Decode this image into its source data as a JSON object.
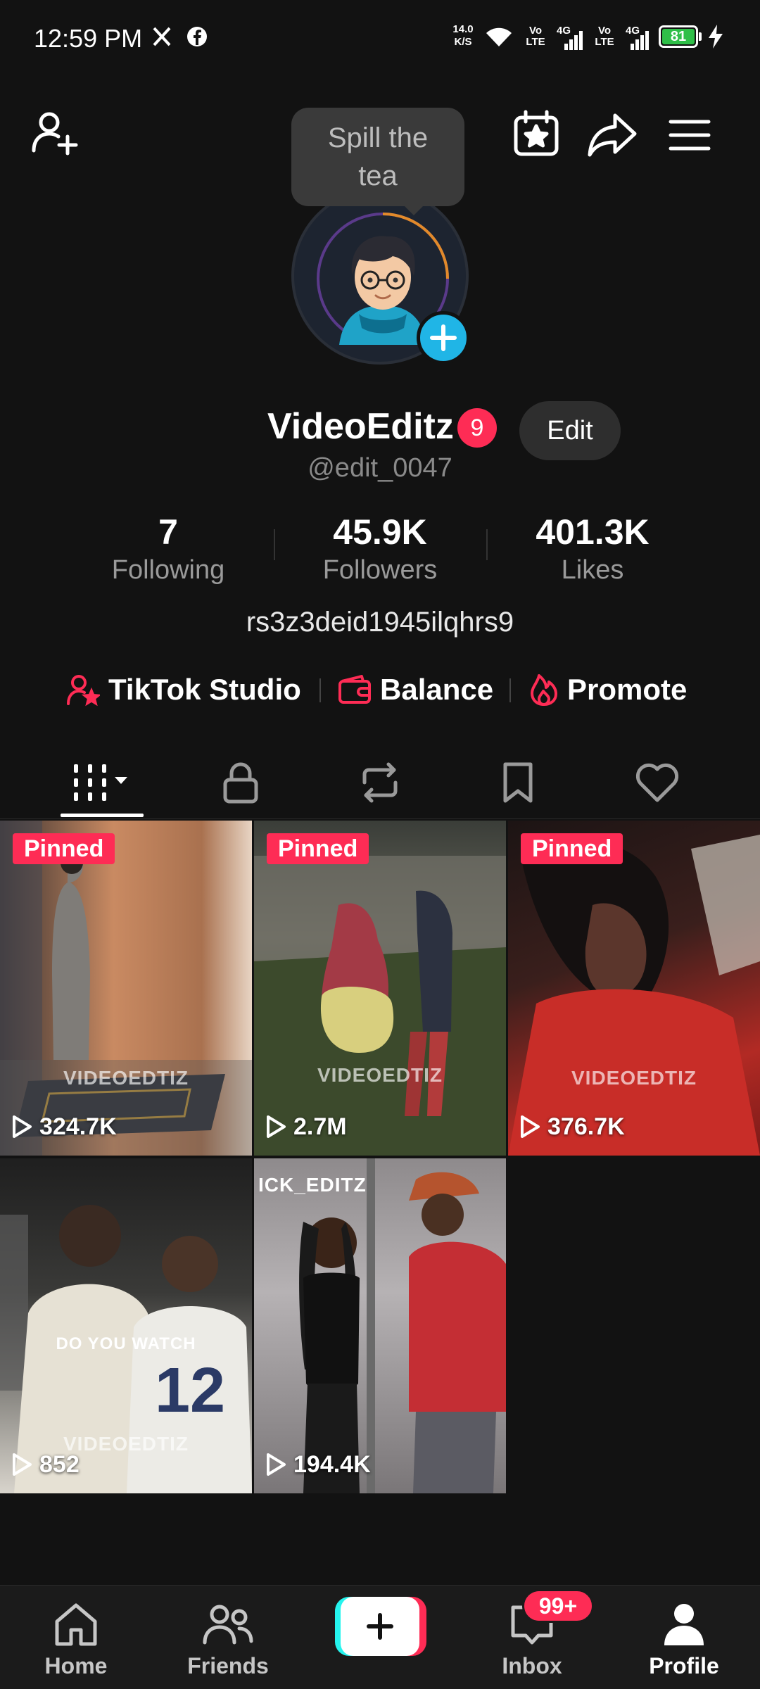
{
  "status_bar": {
    "time": "12:59 PM",
    "net_speed_value": "14.0",
    "net_speed_unit": "K/S",
    "volte_label": "Vo\nLTE",
    "lte1": "Vo LTE",
    "sig1": "4G",
    "lte2": "Vo LTE",
    "sig2": "4G",
    "battery": "81",
    "icons": [
      "x-icon",
      "facebook-icon",
      "wifi-icon",
      "signal-icon",
      "battery-icon",
      "charging-icon"
    ]
  },
  "header": {
    "icons": [
      "add-friend-icon",
      "calendar-star-icon",
      "share-icon",
      "menu-icon"
    ]
  },
  "tooltip": {
    "text": "Spill the tea"
  },
  "profile": {
    "display_name": "VideoEditz",
    "badge_count": "9",
    "edit_label": "Edit",
    "handle": "@edit_0047",
    "bio": "rs3z3deid1945ilqhrs9"
  },
  "stats": [
    {
      "value": "7",
      "label": "Following"
    },
    {
      "value": "45.9K",
      "label": "Followers"
    },
    {
      "value": "401.3K",
      "label": "Likes"
    }
  ],
  "quick_links": [
    {
      "label": "TikTok Studio",
      "icon": "studio-icon"
    },
    {
      "label": "Balance",
      "icon": "wallet-icon"
    },
    {
      "label": "Promote",
      "icon": "flame-icon"
    }
  ],
  "tabs": [
    {
      "name": "videos",
      "icon": "grid-icon",
      "active": true
    },
    {
      "name": "private",
      "icon": "lock-icon"
    },
    {
      "name": "reposts",
      "icon": "repost-icon"
    },
    {
      "name": "favorites",
      "icon": "bookmark-icon"
    },
    {
      "name": "liked",
      "icon": "heart-icon"
    }
  ],
  "videos": [
    {
      "pinned": "Pinned",
      "watermark": "VIDEOEDTIZ",
      "views": "324.7K",
      "bg": "#7a5a45"
    },
    {
      "pinned": "Pinned",
      "watermark": "VIDEOEDTIZ",
      "views": "2.7M",
      "bg": "#4c5142"
    },
    {
      "pinned": "Pinned",
      "watermark": "VIDEOEDTIZ",
      "views": "376.7K",
      "bg": "#5a1f1f"
    },
    {
      "pinned": "",
      "watermark": "VIDEOEDTIZ",
      "overlay": "DO YOU WATCH",
      "views": "852",
      "bg": "#3e3d3a"
    },
    {
      "pinned": "",
      "watermark": "ICK_EDITZ",
      "views": "194.4K",
      "bg": "#6d6a6c"
    }
  ],
  "bottom_nav": [
    {
      "label": "Home",
      "icon": "home-icon"
    },
    {
      "label": "Friends",
      "icon": "friends-icon"
    },
    {
      "label": "",
      "icon": "plus-icon"
    },
    {
      "label": "Inbox",
      "icon": "inbox-icon",
      "badge": "99+"
    },
    {
      "label": "Profile",
      "icon": "profile-icon",
      "active": true
    }
  ],
  "colors": {
    "accent": "#fe2c55",
    "cyan": "#25f4ee",
    "background": "#121212",
    "avatar_plus": "#20b5e6"
  }
}
